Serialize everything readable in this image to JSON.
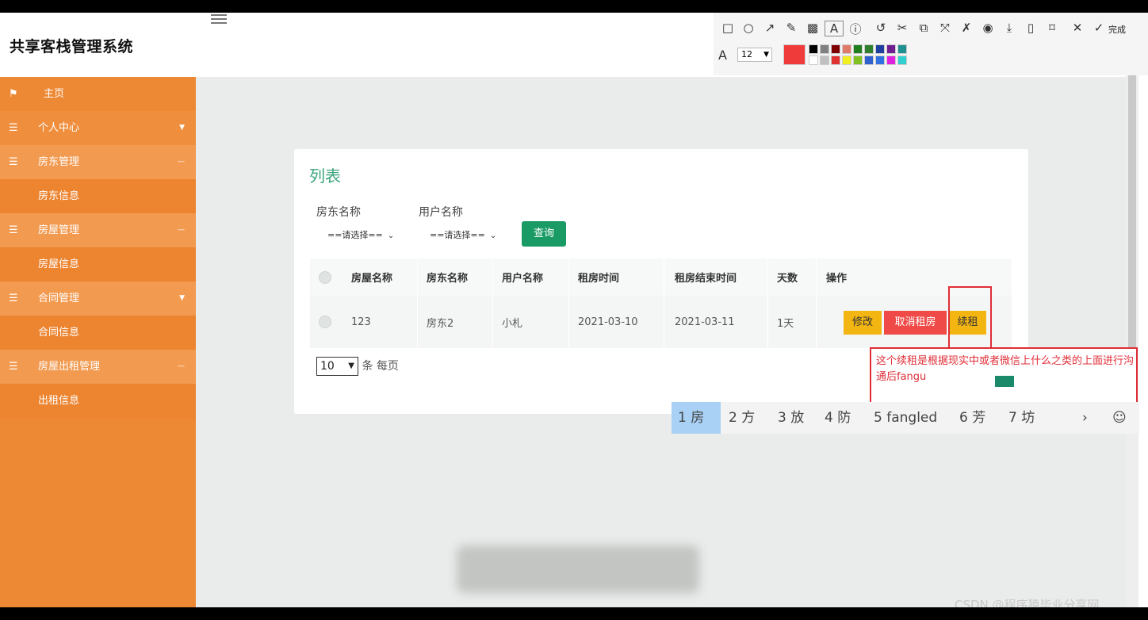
{
  "app": {
    "title": "共享客栈管理系统"
  },
  "sidebar": {
    "home": "主页",
    "items": [
      {
        "label": "个人中心"
      },
      {
        "label": "房东管理"
      },
      {
        "label": "房东信息"
      },
      {
        "label": "房屋管理"
      },
      {
        "label": "房屋信息"
      },
      {
        "label": "合同管理"
      },
      {
        "label": "合同信息"
      },
      {
        "label": "房屋出租管理"
      },
      {
        "label": "出租信息"
      }
    ]
  },
  "card": {
    "title": "列表",
    "filters": {
      "landlord_label": "房东名称",
      "user_label": "用户名称",
      "landlord_value": "==请选择==",
      "user_value": "==请选择==",
      "query_button": "查询"
    },
    "table": {
      "headers": [
        "房屋名称",
        "房东名称",
        "用户名称",
        "租房时间",
        "租房结束时间",
        "天数",
        "操作"
      ],
      "rows": [
        {
          "house": "123",
          "landlord": "房东2",
          "user": "小札",
          "start": "2021-03-10",
          "end": "2021-03-11",
          "days": "1天"
        }
      ],
      "actions": {
        "edit": "修改",
        "cancel": "取消租房",
        "renew": "续租"
      }
    },
    "pager": {
      "page_size": "10",
      "suffix": "条 每页"
    }
  },
  "annotation": {
    "text": "这个续租是根据现实中或者微信上什么之类的上面进行沟通后fangu"
  },
  "ime": {
    "candidates": [
      "1 房",
      "2 方",
      "3 放",
      "4 防",
      "5 fangled",
      "6 芳",
      "7 坊"
    ],
    "next": "›",
    "emoji": "☺"
  },
  "toolbar": {
    "done_label": "完成",
    "font_size": "12",
    "current_color": "#f03b3b",
    "palette_top": [
      "#000000",
      "#808080",
      "#800000",
      "#e07b6a",
      "#1f7f1f",
      "#2f7f2f",
      "#1f3f9f",
      "#6f1f8f",
      "#1f8f8f"
    ],
    "palette_bottom": [
      "#ffffff",
      "#c0c0c0",
      "#e03030",
      "#f0f020",
      "#80c020",
      "#3060d0",
      "#3070e0",
      "#e020e0",
      "#30d0d0"
    ]
  },
  "watermark": "CSDN @程序猿毕业分享网"
}
